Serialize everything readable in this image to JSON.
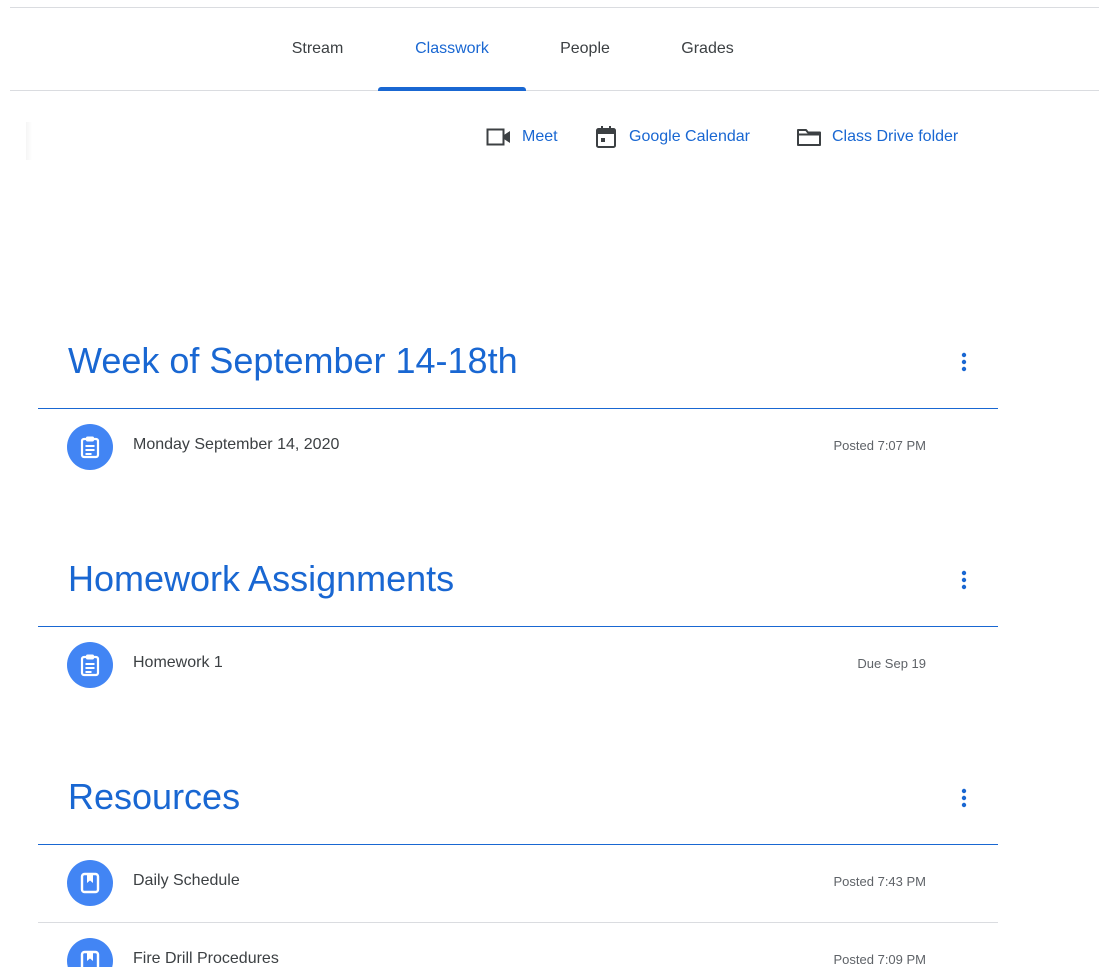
{
  "nav": {
    "tabs": [
      {
        "label": "Stream"
      },
      {
        "label": "Classwork"
      },
      {
        "label": "People"
      },
      {
        "label": "Grades"
      }
    ],
    "active_tab": "Classwork"
  },
  "quick_links": {
    "meet": {
      "label": "Meet",
      "icon": "video-camera-icon"
    },
    "calendar": {
      "label": "Google Calendar",
      "icon": "calendar-icon"
    },
    "drive": {
      "label": "Class Drive folder",
      "icon": "folder-icon"
    }
  },
  "colors": {
    "accent": "#1967d2",
    "badge": "#4285f4",
    "text": "#3c4043",
    "meta": "#5f6368",
    "divider": "#dadce0"
  },
  "topics": [
    {
      "title": "Week of September 14-18th",
      "items": [
        {
          "title": "Monday September 14, 2020",
          "meta": "Posted 7:07 PM",
          "icon": "assignment-icon"
        }
      ]
    },
    {
      "title": "Homework Assignments",
      "items": [
        {
          "title": "Homework 1",
          "meta": "Due Sep 19",
          "icon": "assignment-icon"
        }
      ]
    },
    {
      "title": "Resources",
      "items": [
        {
          "title": "Daily Schedule",
          "meta": "Posted 7:43 PM",
          "icon": "material-icon"
        },
        {
          "title": "Fire Drill Procedures",
          "meta": "Posted 7:09 PM",
          "icon": "material-icon"
        }
      ]
    }
  ]
}
